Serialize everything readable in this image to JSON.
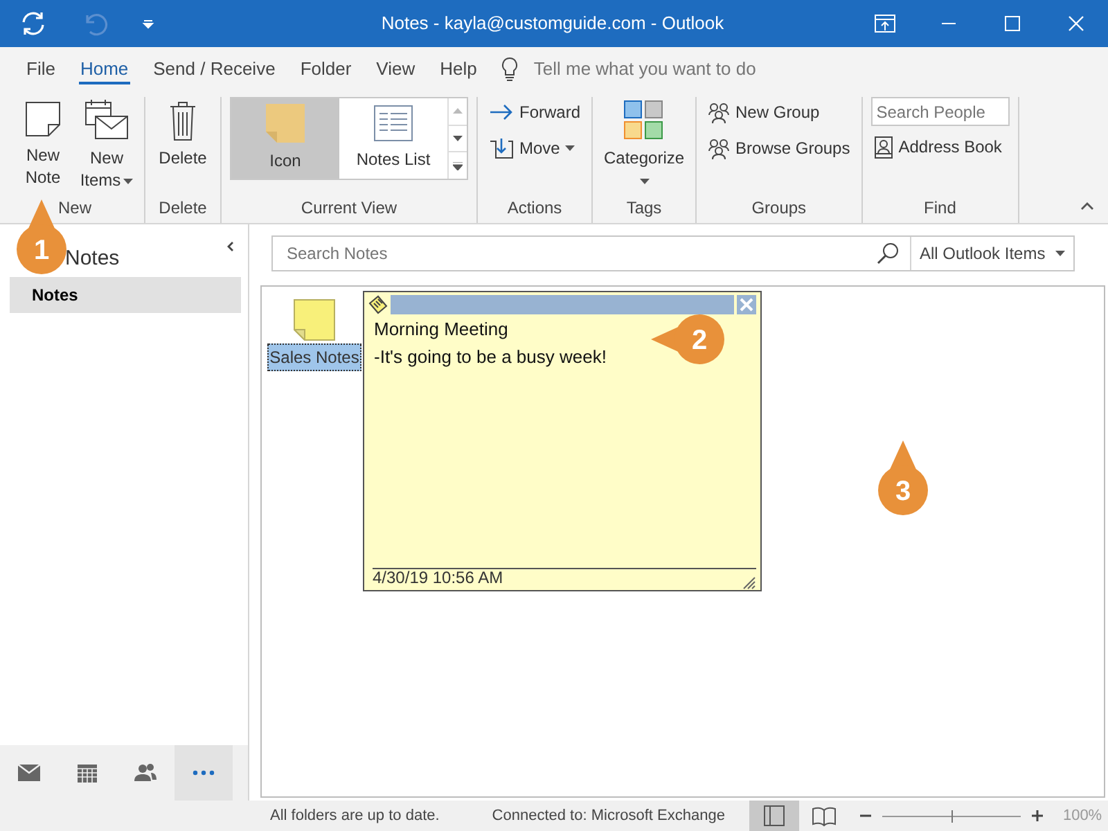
{
  "window": {
    "title": "Notes - kayla@customguide.com - Outlook"
  },
  "menu_tabs": [
    {
      "label": "File",
      "selected": false
    },
    {
      "label": "Home",
      "selected": true
    },
    {
      "label": "Send / Receive",
      "selected": false
    },
    {
      "label": "Folder",
      "selected": false
    },
    {
      "label": "View",
      "selected": false
    },
    {
      "label": "Help",
      "selected": false
    }
  ],
  "tell_me": {
    "placeholder": "Tell me what you want to do"
  },
  "ribbon": {
    "groups": [
      {
        "label": "New",
        "items": [
          {
            "kind": "large",
            "label": "New Note",
            "dropdown": false
          },
          {
            "kind": "large",
            "label": "New Items",
            "dropdown": true
          }
        ]
      },
      {
        "label": "Delete",
        "items": [
          {
            "kind": "large",
            "label": "Delete",
            "dropdown": false
          }
        ]
      },
      {
        "label": "Current View",
        "items": [
          {
            "kind": "gallery",
            "options": [
              {
                "label": "Icon",
                "selected": true
              },
              {
                "label": "Notes List",
                "selected": false
              }
            ]
          }
        ]
      },
      {
        "label": "Actions",
        "items": [
          {
            "kind": "small",
            "label": "Forward",
            "dropdown": false
          },
          {
            "kind": "small",
            "label": "Move",
            "dropdown": true
          }
        ]
      },
      {
        "label": "Tags",
        "items": [
          {
            "kind": "large",
            "label": "Categorize",
            "dropdown": true
          }
        ]
      },
      {
        "label": "Groups",
        "items": [
          {
            "kind": "small",
            "label": "New Group",
            "dropdown": false
          },
          {
            "kind": "small",
            "label": "Browse Groups",
            "dropdown": false
          }
        ]
      },
      {
        "label": "Find",
        "items": [
          {
            "kind": "search",
            "placeholder": "Search People"
          },
          {
            "kind": "small",
            "label": "Address Book",
            "dropdown": false
          }
        ]
      }
    ]
  },
  "folder_pane": {
    "heading": "Notes",
    "folders": [
      {
        "label": "Notes",
        "selected": true
      }
    ],
    "nav": [
      {
        "selected": false
      },
      {
        "selected": false
      },
      {
        "selected": false
      },
      {
        "selected": true
      }
    ]
  },
  "search": {
    "placeholder": "Search Notes",
    "scope": "All Outlook Items"
  },
  "notes": [
    {
      "label": "Sales Notes",
      "selected": true
    }
  ],
  "open_note": {
    "lines": [
      "Morning Meeting",
      "-It's going to be a busy week!"
    ],
    "timestamp": "4/30/19 10:56 AM"
  },
  "status_bar": {
    "texts": [
      "All folders are up to date.",
      "Connected to: Microsoft Exchange"
    ],
    "views": [
      {
        "selected": true
      },
      {
        "selected": false
      }
    ],
    "zoom": {
      "level": 0.5,
      "reading": "100%"
    }
  },
  "callouts": [
    {
      "label": "1"
    },
    {
      "label": "2"
    },
    {
      "label": "3"
    }
  ]
}
